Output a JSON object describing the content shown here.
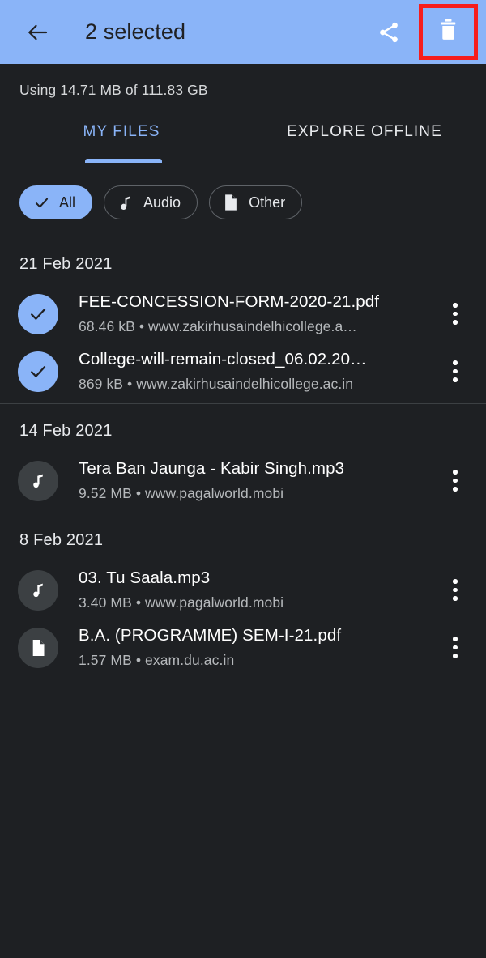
{
  "colors": {
    "appbar_bg": "#8ab4f8",
    "accent": "#8ab4f8",
    "page_bg": "#1e2023",
    "highlight_box": "#f71d1d",
    "primary_text": "#ffffff",
    "secondary_text": "#b5b8bb",
    "avatar_bg": "#3c4043"
  },
  "appbar": {
    "back_icon": "arrow-back-icon",
    "title": "2 selected",
    "share_icon": "share-icon",
    "delete_icon": "trash-icon"
  },
  "storage": {
    "text": "Using 14.71 MB of 111.83 GB"
  },
  "tabs": [
    {
      "label": "MY FILES",
      "active": true
    },
    {
      "label": "EXPLORE OFFLINE",
      "active": false
    }
  ],
  "chips": [
    {
      "label": "All",
      "icon": "check-icon",
      "selected": true
    },
    {
      "label": "Audio",
      "icon": "music-note-icon",
      "selected": false
    },
    {
      "label": "Other",
      "icon": "document-icon",
      "selected": false
    }
  ],
  "sections": [
    {
      "date": "21 Feb 2021",
      "files": [
        {
          "name": "FEE-CONCESSION-FORM-2020-21.pdf",
          "meta": "68.46 kB • www.zakirhusaindelhicollege.a…",
          "icon": "check-icon",
          "selected": true,
          "overflow_icon": "more-vert-icon"
        },
        {
          "name": "College-will-remain-closed_06.02.20…",
          "meta": "869 kB • www.zakirhusaindelhicollege.ac.in",
          "icon": "check-icon",
          "selected": true,
          "overflow_icon": "more-vert-icon"
        }
      ]
    },
    {
      "date": "14 Feb 2021",
      "files": [
        {
          "name": "Tera Ban Jaunga - Kabir Singh.mp3",
          "meta": "9.52 MB • www.pagalworld.mobi",
          "icon": "music-note-icon",
          "selected": false,
          "overflow_icon": "more-vert-icon"
        }
      ]
    },
    {
      "date": "8 Feb 2021",
      "files": [
        {
          "name": "03. Tu Saala.mp3",
          "meta": "3.40 MB • www.pagalworld.mobi",
          "icon": "music-note-icon",
          "selected": false,
          "overflow_icon": "more-vert-icon"
        },
        {
          "name": "B.A. (PROGRAMME) SEM-I-21.pdf",
          "meta": "1.57 MB • exam.du.ac.in",
          "icon": "document-icon",
          "selected": false,
          "overflow_icon": "more-vert-icon"
        }
      ]
    }
  ]
}
